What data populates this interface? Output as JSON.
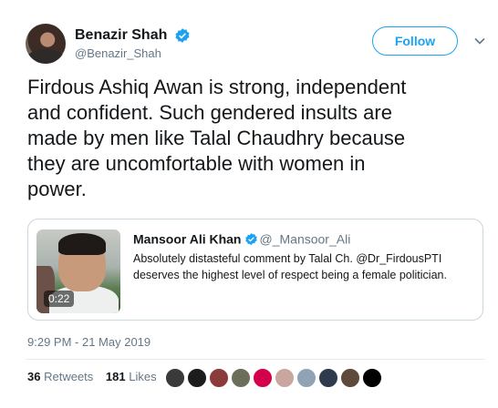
{
  "author": {
    "display_name": "Benazir Shah",
    "handle": "@Benazir_Shah",
    "verified": true
  },
  "follow_label": "Follow",
  "tweet_text": "Firdous Ashiq Awan is strong, independent\nand confident. Such gendered insults are\nmade by men like Talal Chaudhry because\nthey are uncomfortable with women in\npower.",
  "quoted_tweet": {
    "display_name": "Mansoor Ali Khan",
    "handle": "@_Mansoor_Ali",
    "verified": true,
    "text": "Absolutely distasteful comment by Talal Ch. @Dr_FirdousPTI deserves the highest level of respect being a female politician.",
    "video_duration": "0:22"
  },
  "timestamp": "9:29 PM - 21 May 2019",
  "stats": {
    "retweets_count": "36",
    "retweets_label": "Retweets",
    "likes_count": "181",
    "likes_label": "Likes"
  },
  "likers": [
    {
      "color": "#3a3a3a"
    },
    {
      "color": "#1c1c1c"
    },
    {
      "color": "#8b3b3b"
    },
    {
      "color": "#6b6f5a"
    },
    {
      "color": "#d5004c"
    },
    {
      "color": "#c9a7a0"
    },
    {
      "color": "#8fa3b5"
    },
    {
      "color": "#2d3b4d"
    },
    {
      "color": "#5e4a3a"
    },
    {
      "color": "#000000"
    }
  ],
  "colors": {
    "accent": "#1da1f2",
    "text": "#14171a",
    "secondary_text": "#657786",
    "border": "#ccd6dd"
  }
}
